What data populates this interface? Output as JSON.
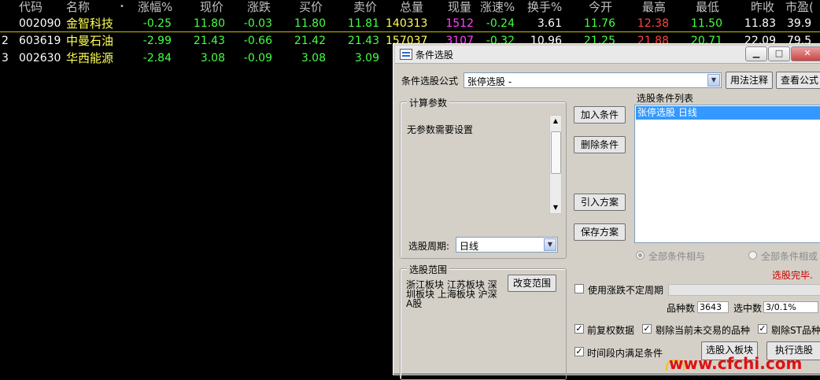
{
  "table": {
    "headers": [
      "代码",
      "名称",
      "•",
      "涨幅%",
      "现价",
      "涨跌",
      "买价",
      "卖价",
      "总量",
      "现量",
      "涨速%",
      "换手%",
      "今开",
      "最高",
      "最低",
      "昨收",
      "市盈("
    ],
    "rows": [
      {
        "idx": "",
        "code": "002090",
        "name": "金智科技",
        "pct": "-0.25",
        "price": "11.80",
        "chg": "-0.03",
        "bid": "11.80",
        "ask": "11.81",
        "vol": "140313",
        "cur": "1512",
        "speed": "-0.24",
        "turn": "3.61",
        "open": "11.76",
        "high": "12.38",
        "low": "11.50",
        "prev": "11.83",
        "pe": "39.9"
      },
      {
        "idx": "2",
        "code": "603619",
        "name": "中曼石油",
        "pct": "-2.99",
        "price": "21.43",
        "chg": "-0.66",
        "bid": "21.42",
        "ask": "21.43",
        "vol": "157037",
        "cur": "3107",
        "speed": "-0.32",
        "turn": "10.96",
        "open": "21.25",
        "high": "21.88",
        "low": "20.71",
        "prev": "22.09",
        "pe": "79.5"
      },
      {
        "idx": "3",
        "code": "002630",
        "name": "华西能源",
        "pct": "-2.84",
        "price": "3.08",
        "chg": "-0.09",
        "bid": "3.08",
        "ask": "3.09",
        "vol": "",
        "cur": "",
        "speed": "",
        "turn": "",
        "open": "",
        "high": "",
        "low": "",
        "prev": "",
        "pe": ""
      }
    ]
  },
  "dialog": {
    "title": "条件选股",
    "formula_label": "条件选股公式",
    "formula_value": "张停选股        -",
    "usage_btn": "用法注释",
    "view_btn": "查看公式",
    "params_group": "计算参数",
    "params_text": "无参数需要设置",
    "add_btn": "加入条件",
    "del_btn": "删除条件",
    "import_btn": "引入方案",
    "save_btn": "保存方案",
    "cond_list_label": "选股条件列表",
    "cond_items": [
      "张停选股    日线"
    ],
    "period_label": "选股周期:",
    "period_value": "日线",
    "radio_and": "全部条件相与",
    "radio_or": "全部条件相或",
    "status": "选股完毕.",
    "range_group": "选股范围",
    "range_text": "浙江板块 江苏板块 深圳板块 上海板块 沪深A股",
    "change_range_btn": "改变范围",
    "chk_uncertain": "使用涨跌不定周期",
    "count_label": "品种数",
    "count_value": "3643",
    "selected_label": "选中数",
    "selected_value": "3/0.1%",
    "chk_adjust": "前复权数据",
    "chk_exclude_untraded": "剔除当前未交易的品种",
    "chk_exclude_st": "剔除ST品种",
    "chk_period": "时间段内满足条件",
    "to_block_btn": "选股入板块",
    "exec_btn": "执行选股"
  },
  "watermark": "www.cfchi.com",
  "colors": {
    "background": "#000000",
    "dialog_bg": "#d4d0c8",
    "selection": "#3399ff",
    "status_red": "#cc0000"
  }
}
